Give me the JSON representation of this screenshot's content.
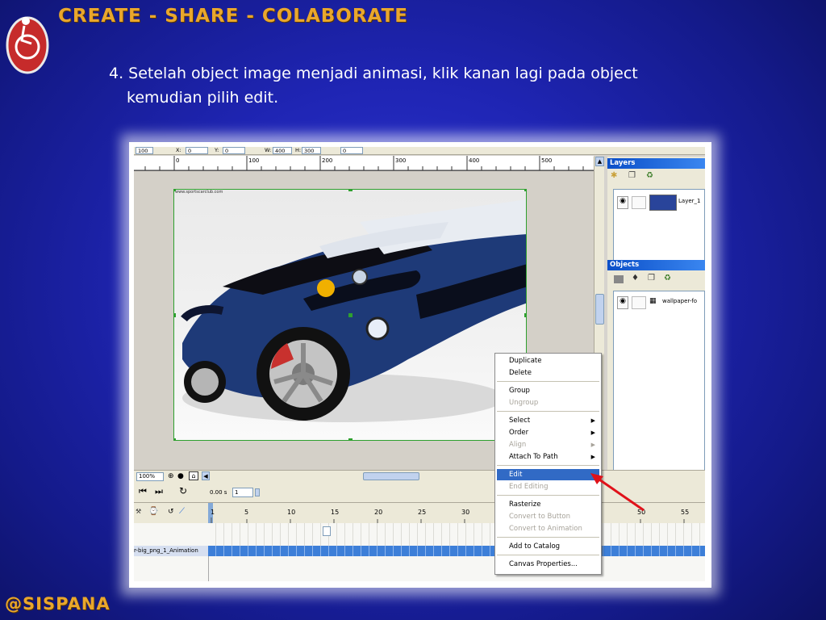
{
  "slide": {
    "header": "CREATE - SHARE - COLABORATE",
    "bullet_line1": "4. Setelah object image menjadi animasi, klik kanan lagi pada object",
    "bullet_line2": "kemudian pilih edit.",
    "footer": "@SISPANA"
  },
  "app": {
    "toolbar": {
      "zoom_field": "100",
      "x_label": "X:",
      "x_value": "0",
      "y_label": "Y:",
      "y_value": "0",
      "w_label": "W:",
      "w_value": "400",
      "h_label": "H:",
      "h_value": "300",
      "angle_value": "0"
    },
    "ruler_ticks": [
      "0",
      "100",
      "200",
      "300",
      "400",
      "500"
    ],
    "image_caption": "www.sportscarclub.com",
    "layers_panel": {
      "title": "Layers",
      "item_label": "Layer_1"
    },
    "objects_panel": {
      "title": "Objects",
      "item_label": "wallpaper-fo"
    },
    "zoom_level": "100%",
    "timeline": {
      "time_value": "0.00 s",
      "frame_value": "1",
      "frame_numbers": [
        "1",
        "5",
        "10",
        "15",
        "20",
        "25",
        "30",
        "50",
        "55"
      ],
      "track_label": "r-big_png_1_Animation"
    },
    "context_menu": {
      "items": [
        {
          "label": "Duplicate",
          "enabled": true
        },
        {
          "label": "Delete",
          "enabled": true
        },
        {
          "label": "Group",
          "enabled": true
        },
        {
          "label": "Ungroup",
          "enabled": false
        },
        {
          "label": "Select",
          "enabled": true,
          "submenu": true
        },
        {
          "label": "Order",
          "enabled": true,
          "submenu": true
        },
        {
          "label": "Align",
          "enabled": false,
          "submenu": true
        },
        {
          "label": "Attach To Path",
          "enabled": true,
          "submenu": true
        },
        {
          "label": "Edit",
          "enabled": true,
          "highlighted": true
        },
        {
          "label": "End Editing",
          "enabled": false
        },
        {
          "label": "Rasterize",
          "enabled": true
        },
        {
          "label": "Convert to Button",
          "enabled": false
        },
        {
          "label": "Convert to Animation",
          "enabled": false
        },
        {
          "label": "Add to Catalog",
          "enabled": true
        },
        {
          "label": "Canvas Properties...",
          "enabled": true
        }
      ]
    }
  },
  "colors": {
    "header_accent": "#e9a72c",
    "menu_highlight": "#316ac5",
    "panel_title": "#0b4fc8",
    "pointer_arrow": "#e0121a",
    "timeline_track": "#3d7fd8"
  }
}
